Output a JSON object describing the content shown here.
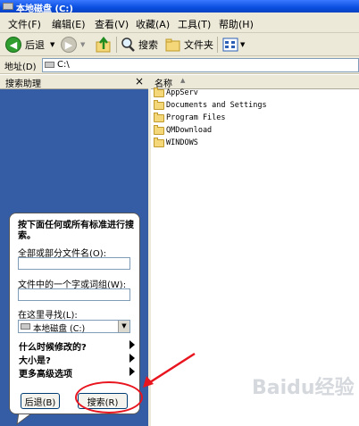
{
  "window": {
    "title": "本地磁盘 (C:)"
  },
  "menu": [
    "文件(F)",
    "编辑(E)",
    "查看(V)",
    "收藏(A)",
    "工具(T)",
    "帮助(H)"
  ],
  "toolbar": {
    "back_label": "后退",
    "search_label": "搜索",
    "folders_label": "文件夹"
  },
  "address": {
    "label": "地址(D)",
    "value": "C:\\"
  },
  "search_pane": {
    "title": "搜索助理",
    "close_glyph": "×",
    "prompt": "按下面任何或所有标准进行搜索。",
    "filename_label": "全部或部分文件名(O):",
    "filename_value": "",
    "phrase_label": "文件中的一个字或词组(W):",
    "phrase_value": "",
    "lookin_label": "在这里寻找(L):",
    "lookin_value": "本地磁盘 (C:)",
    "options": [
      "什么时候修改的?",
      "大小是?",
      "更多高级选项"
    ],
    "back_button": "后退(B)",
    "search_button": "搜索(R)"
  },
  "file_list": {
    "column_name": "名称",
    "items": [
      "AppServ",
      "Documents and Settings",
      "Program Files",
      "QMDownload",
      "WINDOWS"
    ]
  },
  "watermark": "Baidu经验",
  "colors": {
    "pane_blue": "#355da6",
    "annotation_red": "#e8141e",
    "title_blue": "#0a4fe0"
  }
}
